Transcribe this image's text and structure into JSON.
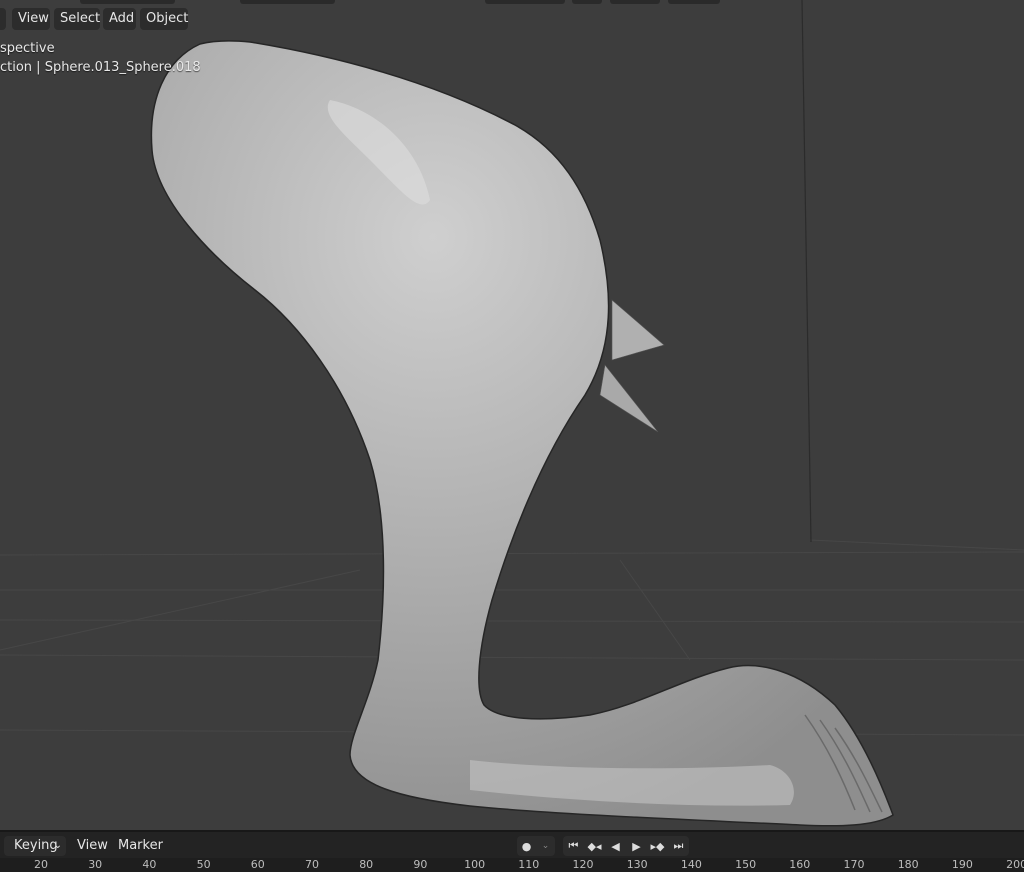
{
  "header": {
    "menus": [
      {
        "label": "View"
      },
      {
        "label": "Select"
      },
      {
        "label": "Add"
      },
      {
        "label": "Object"
      }
    ]
  },
  "viewport": {
    "view_label": "spective",
    "collection_label": "ction | Sphere.013_Sphere.018"
  },
  "timeline": {
    "keying_label": "Keying",
    "view_label": "View",
    "marker_label": "Marker",
    "frames": [
      "20",
      "30",
      "40",
      "50",
      "60",
      "70",
      "80",
      "90",
      "100",
      "110",
      "120",
      "130",
      "140",
      "150",
      "160",
      "170",
      "180",
      "190",
      "200"
    ]
  },
  "colors": {
    "viewport_bg": "#3d3d3d",
    "mesh": "#a9a9a9",
    "timeline_bg": "#232323"
  }
}
